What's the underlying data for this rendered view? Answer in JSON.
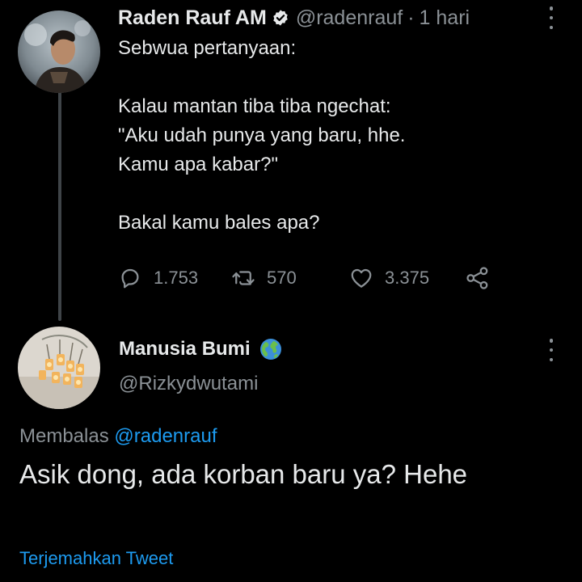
{
  "tweet": {
    "author_name": "Raden Rauf AM",
    "handle": "@radenrauf",
    "separator": "·",
    "time": "1 hari",
    "body": "Sebwua pertanyaan:\n\nKalau mantan tiba tiba ngechat:\n\"Aku udah punya yang baru, hhe.\nKamu apa kabar?\"\n\nBakal kamu bales apa?",
    "replies": "1.753",
    "retweets": "570",
    "likes": "3.375"
  },
  "reply": {
    "author_name": "Manusia Bumi",
    "handle": "@Rizkydwutami",
    "replying_label": "Membalas",
    "replying_to": "@radenrauf",
    "body": "Asik dong, ada korban baru ya? Hehe",
    "translate_label": "Terjemahkan Tweet"
  },
  "colors": {
    "background": "#000000",
    "text": "#e7e9ea",
    "muted": "#8b9196",
    "link": "#1d9bf0",
    "thread_line": "#3f4448"
  },
  "icons": {
    "verified": "verified-badge-icon",
    "more": "more-options-icon",
    "reply": "reply-icon",
    "retweet": "retweet-icon",
    "like": "heart-icon",
    "share": "share-icon",
    "emoji": "globe-emoji-icon"
  }
}
